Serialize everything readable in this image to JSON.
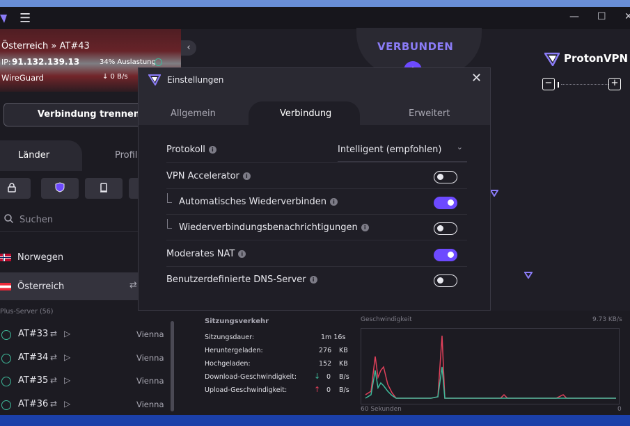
{
  "titlebar": {
    "menu": "☰",
    "minimize": "—",
    "maximize": "☐",
    "close": "✕"
  },
  "status": {
    "location": "Österreich » AT#43",
    "ip_label": "IP:",
    "ip": "91.132.139.13",
    "load": "34% Auslastung",
    "protocol": "WireGuard",
    "speed": "↓ 0 B/s",
    "disconnect": "Verbindung trennen"
  },
  "left_tabs": {
    "countries": "Länder",
    "profiles": "Profile"
  },
  "search": {
    "placeholder": "Suchen"
  },
  "countries": [
    {
      "name": "Norwegen"
    },
    {
      "name": "Österreich"
    }
  ],
  "plus_header": "Plus-Server (56)",
  "servers": [
    {
      "name": "AT#33",
      "city": "Vienna"
    },
    {
      "name": "AT#34",
      "city": "Vienna"
    },
    {
      "name": "AT#35",
      "city": "Vienna"
    },
    {
      "name": "AT#36",
      "city": "Vienna"
    }
  ],
  "map": {
    "status": "VERBUNDEN",
    "brand": "ProtonVPN",
    "zoom_out": "−",
    "zoom_in": "+"
  },
  "stats": {
    "title": "Sitzungsverkehr",
    "rows": [
      {
        "label": "Sitzungsdauer:",
        "value": "1m 16s",
        "unit": ""
      },
      {
        "label": "Heruntergeladen:",
        "value": "276",
        "unit": "KB"
      },
      {
        "label": "Hochgeladen:",
        "value": "152",
        "unit": "KB"
      },
      {
        "label": "Download-Geschwindigkeit:",
        "value": "0",
        "unit": "B/s"
      },
      {
        "label": "Upload-Geschwindigkeit:",
        "value": "0",
        "unit": "B/s"
      }
    ],
    "graph_title": "Geschwindigkeit",
    "graph_max": "9.73 KB/s",
    "graph_x_left": "60 Sekunden",
    "graph_x_right": "0",
    "colors": {
      "download": "#3fb99a",
      "upload": "#e0405a"
    }
  },
  "dialog": {
    "title": "Einstellungen",
    "tabs": [
      "Allgemein",
      "Verbindung",
      "Erweitert"
    ],
    "active_tab": "Verbindung",
    "protocol_label": "Protokoll",
    "protocol_value": "Intelligent (empfohlen)",
    "settings": [
      {
        "label": "VPN Accelerator",
        "on": false,
        "indent": false
      },
      {
        "label": "Automatisches Wiederverbinden",
        "on": true,
        "indent": true
      },
      {
        "label": "Wiederverbindungsbenachrichtigungen",
        "on": false,
        "indent": true
      },
      {
        "label": "Moderates NAT",
        "on": true,
        "indent": false
      },
      {
        "label": "Benutzerdefinierte DNS-Server",
        "on": false,
        "indent": false
      }
    ]
  },
  "accent": "#6d4aff"
}
